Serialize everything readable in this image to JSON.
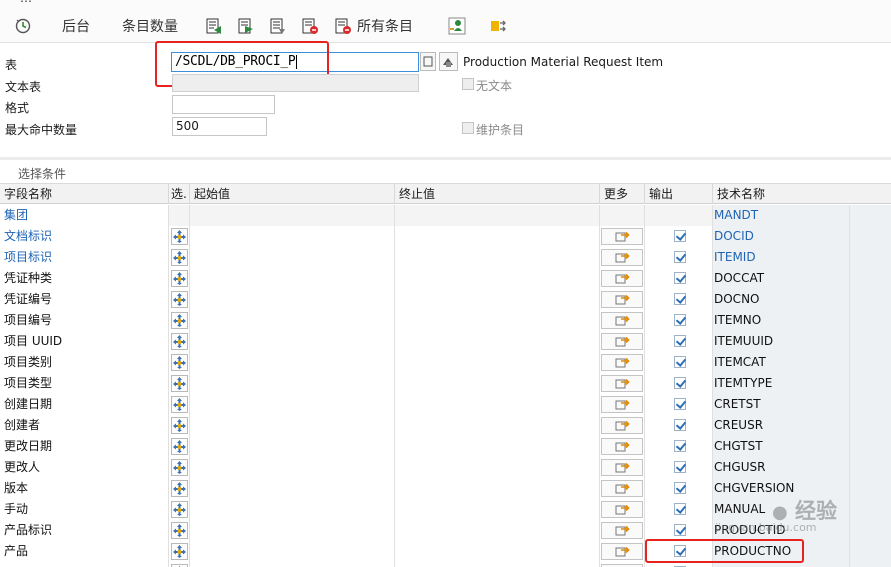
{
  "toolbar": {
    "top_partial": "…",
    "execute_icon": "execute-clock-icon",
    "background_label": "后台",
    "count_label": "条目数量",
    "all_entries_label": "所有条目"
  },
  "form": {
    "table_label": "表",
    "table_value": "/SCDL/DB_PROCI_P",
    "table_description": "Production Material  Request Item",
    "text_table_label": "文本表",
    "text_table_value": "",
    "no_text_label": "无文本",
    "layout_label": "格式",
    "layout_value": "",
    "max_hits_label": "最大命中数量",
    "max_hits_value": "500",
    "maintain_entries_label": "维护条目"
  },
  "section": {
    "title": "选择条件"
  },
  "grid": {
    "headers": {
      "field_name": "字段名称",
      "select": "选.",
      "from": "起始值",
      "to": "终止值",
      "more": "更多",
      "output": "输出",
      "tech_name": "技术名称"
    },
    "rows": [
      {
        "name": "集团",
        "tech": "MANDT",
        "key": true,
        "has_controls": false
      },
      {
        "name": "文档标识",
        "tech": "DOCID",
        "key": true,
        "has_controls": true
      },
      {
        "name": "项目标识",
        "tech": "ITEMID",
        "key": true,
        "has_controls": true
      },
      {
        "name": "凭证种类",
        "tech": "DOCCAT",
        "key": false,
        "has_controls": true
      },
      {
        "name": "凭证编号",
        "tech": "DOCNO",
        "key": false,
        "has_controls": true
      },
      {
        "name": "项目编号",
        "tech": "ITEMNO",
        "key": false,
        "has_controls": true
      },
      {
        "name": "项目 UUID",
        "tech": "ITEMUUID",
        "key": false,
        "has_controls": true
      },
      {
        "name": "项目类别",
        "tech": "ITEMCAT",
        "key": false,
        "has_controls": true
      },
      {
        "name": "项目类型",
        "tech": "ITEMTYPE",
        "key": false,
        "has_controls": true
      },
      {
        "name": "创建日期",
        "tech": "CRETST",
        "key": false,
        "has_controls": true
      },
      {
        "name": "创建者",
        "tech": "CREUSR",
        "key": false,
        "has_controls": true
      },
      {
        "name": "更改日期",
        "tech": "CHGTST",
        "key": false,
        "has_controls": true
      },
      {
        "name": "更改人",
        "tech": "CHGUSR",
        "key": false,
        "has_controls": true
      },
      {
        "name": "版本",
        "tech": "CHGVERSION",
        "key": false,
        "has_controls": true
      },
      {
        "name": "手动",
        "tech": "MANUAL",
        "key": false,
        "has_controls": true
      },
      {
        "name": "产品标识",
        "tech": "PRODUCTID",
        "key": false,
        "has_controls": true
      },
      {
        "name": "产品",
        "tech": "PRODUCTNO",
        "key": false,
        "has_controls": true
      },
      {
        "name": "…",
        "tech": "",
        "key": false,
        "has_controls": true
      }
    ]
  },
  "watermark": {
    "brand": "经验",
    "url": "jingyan.baidu.com"
  },
  "colors": {
    "highlight_red": "#e8231f",
    "key_blue": "#1e64b4",
    "check_blue": "#2b6fb7"
  }
}
